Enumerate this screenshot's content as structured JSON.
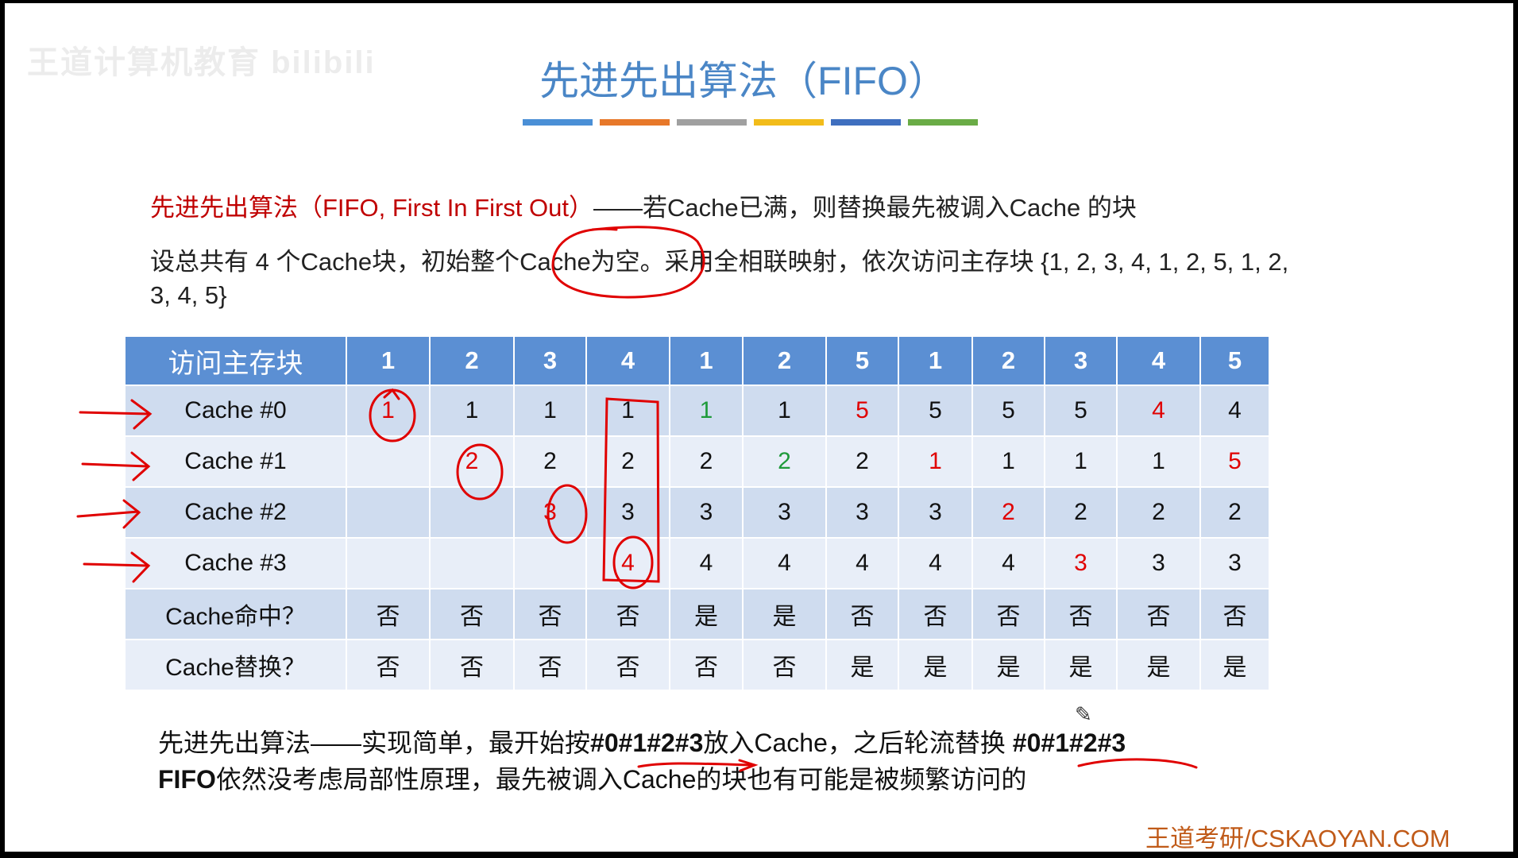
{
  "watermark": "王道计算机教育 bilibili",
  "title": "先进先出算法（FIFO）",
  "colors": {
    "title": "#4a86c6",
    "bar": [
      "#4a8fd6",
      "#e7782a",
      "#a0a0a0",
      "#f2bc1a",
      "#3f6fbf",
      "#6aac46"
    ],
    "header_bg": "#5b8fd3",
    "annotation": "#e00000"
  },
  "definition": {
    "term": "先进先出算法（FIFO, First In First Out）",
    "text": "——若Cache已满，则替换最先被调入Cache 的块"
  },
  "setup": "设总共有 4 个Cache块，初始整个Cache为空。采用全相联映射，依次访问主存块 {1, 2, 3, 4, 1, 2, 5, 1, 2, 3, 4, 5}",
  "table": {
    "header_label": "访问主存块",
    "accesses": [
      "1",
      "2",
      "3",
      "4",
      "1",
      "2",
      "5",
      "1",
      "2",
      "3",
      "4",
      "5"
    ],
    "rows": [
      {
        "label": "Cache #0",
        "cells": [
          {
            "v": "1",
            "c": "red"
          },
          {
            "v": "1"
          },
          {
            "v": "1"
          },
          {
            "v": "1"
          },
          {
            "v": "1",
            "c": "green"
          },
          {
            "v": "1"
          },
          {
            "v": "5",
            "c": "red"
          },
          {
            "v": "5"
          },
          {
            "v": "5"
          },
          {
            "v": "5"
          },
          {
            "v": "4",
            "c": "red"
          },
          {
            "v": "4"
          }
        ]
      },
      {
        "label": "Cache #1",
        "cells": [
          {
            "v": ""
          },
          {
            "v": "2",
            "c": "red"
          },
          {
            "v": "2"
          },
          {
            "v": "2"
          },
          {
            "v": "2"
          },
          {
            "v": "2",
            "c": "green"
          },
          {
            "v": "2"
          },
          {
            "v": "1",
            "c": "red"
          },
          {
            "v": "1"
          },
          {
            "v": "1"
          },
          {
            "v": "1"
          },
          {
            "v": "5",
            "c": "red"
          }
        ]
      },
      {
        "label": "Cache #2",
        "cells": [
          {
            "v": ""
          },
          {
            "v": ""
          },
          {
            "v": "3",
            "c": "red"
          },
          {
            "v": "3"
          },
          {
            "v": "3"
          },
          {
            "v": "3"
          },
          {
            "v": "3"
          },
          {
            "v": "3"
          },
          {
            "v": "2",
            "c": "red"
          },
          {
            "v": "2"
          },
          {
            "v": "2"
          },
          {
            "v": "2"
          }
        ]
      },
      {
        "label": "Cache #3",
        "cells": [
          {
            "v": ""
          },
          {
            "v": ""
          },
          {
            "v": ""
          },
          {
            "v": "4",
            "c": "red"
          },
          {
            "v": "4"
          },
          {
            "v": "4"
          },
          {
            "v": "4"
          },
          {
            "v": "4"
          },
          {
            "v": "4"
          },
          {
            "v": "3",
            "c": "red"
          },
          {
            "v": "3"
          },
          {
            "v": "3"
          }
        ]
      },
      {
        "label": "Cache命中？",
        "cells": [
          {
            "v": "否"
          },
          {
            "v": "否"
          },
          {
            "v": "否"
          },
          {
            "v": "否"
          },
          {
            "v": "是"
          },
          {
            "v": "是"
          },
          {
            "v": "否"
          },
          {
            "v": "否"
          },
          {
            "v": "否"
          },
          {
            "v": "否"
          },
          {
            "v": "否"
          },
          {
            "v": "否"
          }
        ]
      },
      {
        "label": "Cache替换？",
        "cells": [
          {
            "v": "否"
          },
          {
            "v": "否"
          },
          {
            "v": "否"
          },
          {
            "v": "否"
          },
          {
            "v": "否"
          },
          {
            "v": "否"
          },
          {
            "v": "是"
          },
          {
            "v": "是"
          },
          {
            "v": "是"
          },
          {
            "v": "是"
          },
          {
            "v": "是"
          },
          {
            "v": "是"
          }
        ]
      }
    ]
  },
  "summary": {
    "line1_a": "先进先出算法——实现简单，最开始按",
    "line1_b": "#0#1#2#3",
    "line1_c": "放入Cache，之后轮流替换 ",
    "line1_d": "#0#1#2#3",
    "line2_a": "FIFO",
    "line2_b": "依然没考虑局部性原理，最先被调入Cache的块也有可能是被频繁访问的"
  },
  "brand": "王道考研/CSKAOYAN.COM",
  "pencil_icon": "pencil-icon"
}
